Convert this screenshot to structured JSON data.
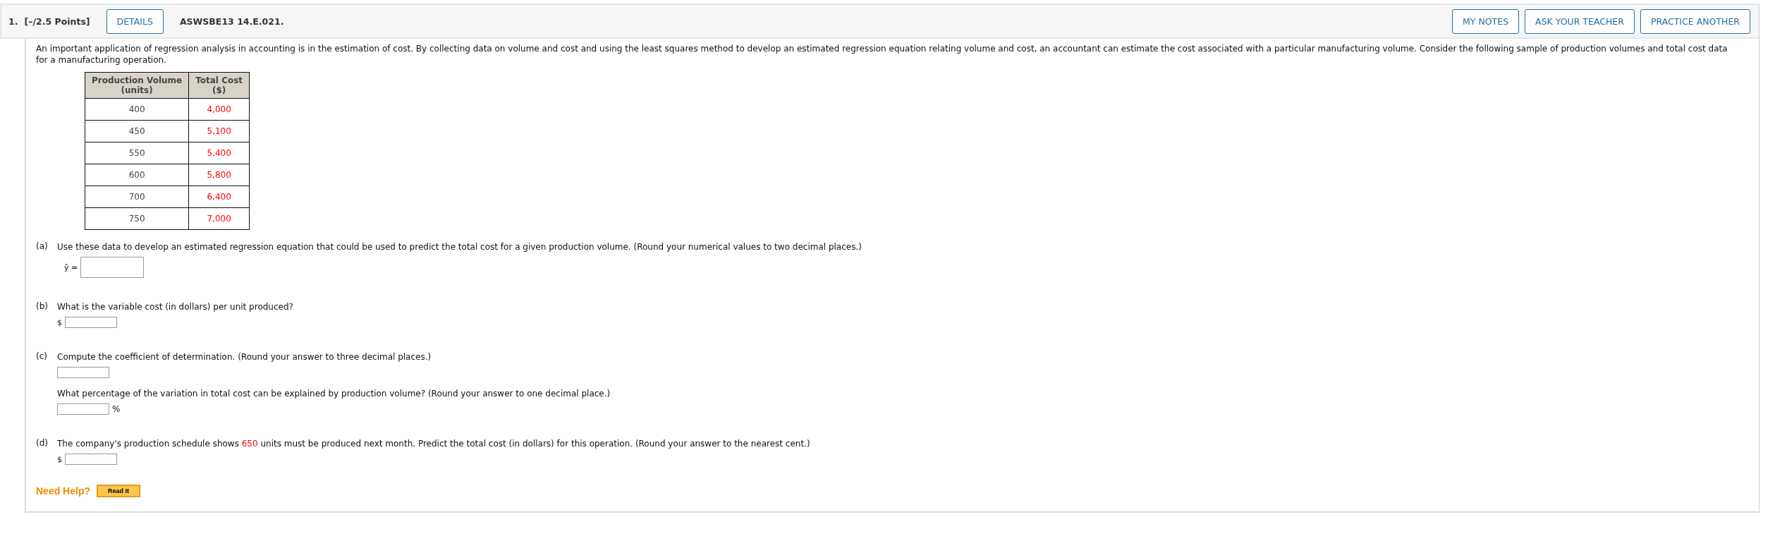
{
  "header": {
    "number": "1.",
    "points": "[–/2.5 Points]",
    "details_button": "DETAILS",
    "code": "ASWSBE13 14.E.021.",
    "buttons": [
      "MY NOTES",
      "ASK YOUR TEACHER",
      "PRACTICE ANOTHER"
    ]
  },
  "intro": "An important application of regression analysis in accounting is in the estimation of cost. By collecting data on volume and cost and using the least squares method to develop an estimated regression equation relating volume and cost, an accountant can estimate the cost associated with a particular manufacturing volume. Consider the following sample of production volumes and total cost data for a manufacturing operation.",
  "table": {
    "columns": [
      "Production Volume\n(units)",
      "Total Cost\n($)"
    ],
    "rows": [
      [
        "400",
        "4,000"
      ],
      [
        "450",
        "5,100"
      ],
      [
        "550",
        "5,400"
      ],
      [
        "600",
        "5,800"
      ],
      [
        "700",
        "6,400"
      ],
      [
        "750",
        "7,000"
      ]
    ]
  },
  "questions": [
    {
      "label": "(a)",
      "items": [
        {
          "kind": "text",
          "parts": [
            {
              "text": "Use these data to develop an estimated regression equation that could be used to predict the total cost for a given production volume. (Round your numerical values to two decimal places.)",
              "kind": "plain"
            }
          ]
        },
        {
          "kind": "wide_field",
          "prefix": "ŷ ="
        }
      ]
    },
    {
      "label": "(b)",
      "items": [
        {
          "kind": "text",
          "parts": [
            {
              "text": "What is the variable cost (in dollars) per unit produced?",
              "kind": "plain"
            }
          ]
        },
        {
          "kind": "field",
          "prefix": "$"
        }
      ]
    },
    {
      "label": "(c)",
      "items": [
        {
          "kind": "text",
          "parts": [
            {
              "text": "Compute the coefficient of determination. (Round your answer to three decimal places.)",
              "kind": "plain"
            }
          ]
        },
        {
          "kind": "field"
        },
        {
          "kind": "text",
          "parts": [
            {
              "text": "What percentage of the variation in total cost can be explained by production volume? (Round your answer to one decimal place.)",
              "kind": "plain"
            }
          ]
        },
        {
          "kind": "field",
          "suffix": "%"
        }
      ]
    },
    {
      "label": "(d)",
      "items": [
        {
          "kind": "text",
          "parts": [
            {
              "kind": "plain",
              "text": "The company's production schedule shows "
            },
            {
              "kind": "given",
              "text": "650"
            },
            {
              "kind": "plain",
              "text": " units must be produced next month. Predict the total cost (in dollars) for this operation. (Round your answer to the nearest cent.)"
            }
          ]
        },
        {
          "kind": "field",
          "prefix": "$"
        }
      ]
    }
  ],
  "help": {
    "label": "Need Help?",
    "button": "Read It"
  }
}
